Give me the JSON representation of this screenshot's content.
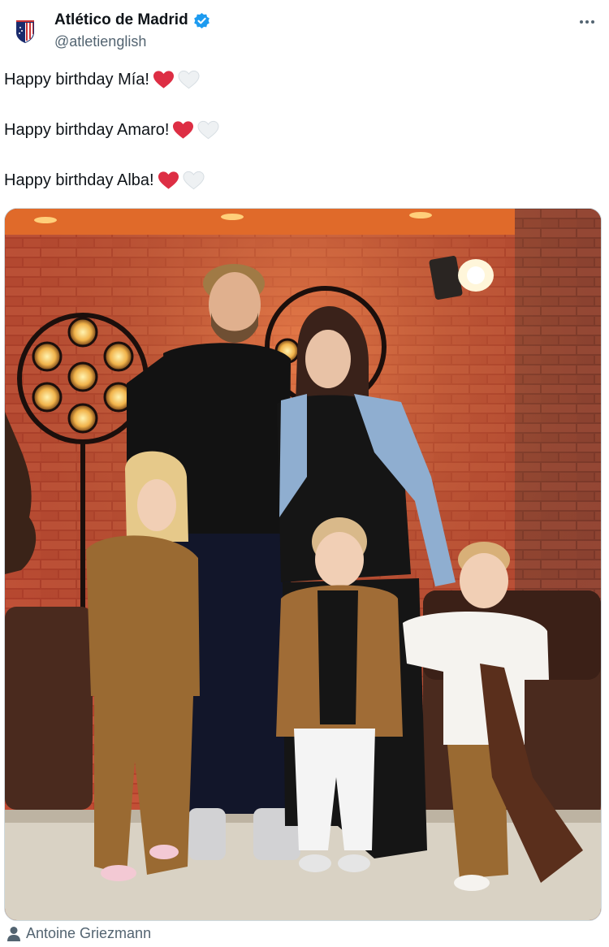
{
  "account": {
    "display_name": "Atlético de Madrid",
    "handle": "@atletienglish",
    "verified": true,
    "avatar_icon": "atletico-crest-icon"
  },
  "tweet": {
    "lines": [
      {
        "text": "Happy birthday Mía!",
        "emoji": [
          "red-heart",
          "white-heart"
        ]
      },
      {
        "text": "Happy birthday Amaro!",
        "emoji": [
          "red-heart",
          "white-heart"
        ]
      },
      {
        "text": "Happy birthday Alba!",
        "emoji": [
          "red-heart",
          "white-heart"
        ]
      }
    ]
  },
  "media": {
    "tagged_user": "Antoine Griezmann",
    "tag_icon": "person-icon"
  },
  "colors": {
    "verified_blue": "#1d9bf0",
    "heart_red": "#dd2e44",
    "heart_white": "#e1e8ed",
    "secondary_text": "#536471"
  }
}
